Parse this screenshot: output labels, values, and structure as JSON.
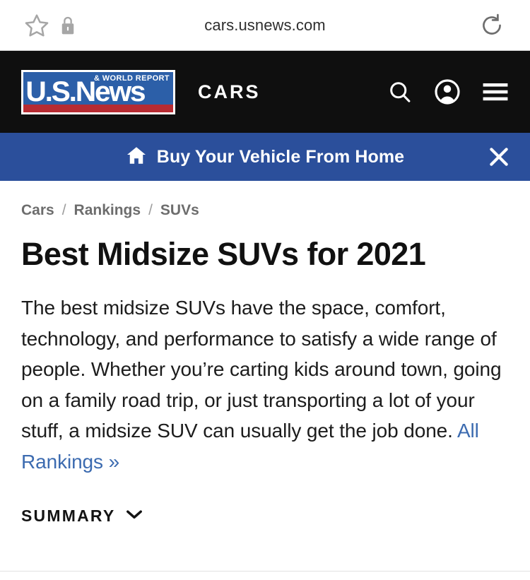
{
  "browser": {
    "url": "cars.usnews.com",
    "bookmark_icon": "star-icon",
    "security_icon": "lock-icon",
    "reload_icon": "reload-icon"
  },
  "header": {
    "logo_name": "U.S.News",
    "logo_tagline": "& WORLD REPORT",
    "section": "CARS",
    "search_icon": "search-icon",
    "account_icon": "account-icon",
    "menu_icon": "hamburger-menu-icon"
  },
  "banner": {
    "home_icon": "home-icon",
    "text": "Buy Your Vehicle From Home",
    "close_icon": "close-icon"
  },
  "breadcrumb": {
    "items": [
      "Cars",
      "Rankings",
      "SUVs"
    ],
    "separator": "/"
  },
  "main": {
    "title": "Best Midsize SUVs for 2021",
    "intro_text": "The best midsize SUVs have the space, comfort, technology, and performance to satisfy a wide range of people. Whether you’re carting kids around town, going on a family road trip, or just transporting a lot of your stuff, a midsize SUV can usually get the job done. ",
    "intro_link": "All Rankings »",
    "summary_label": "SUMMARY",
    "summary_chevron": "chevron-down-icon"
  },
  "colors": {
    "header_bg": "#0f0f0f",
    "banner_blue": "#2b4f9b",
    "logo_blue": "#2c5fa8",
    "logo_red": "#b72b32",
    "link_blue": "#3c6bb0",
    "breadcrumb_gray": "#6d6d6d"
  }
}
